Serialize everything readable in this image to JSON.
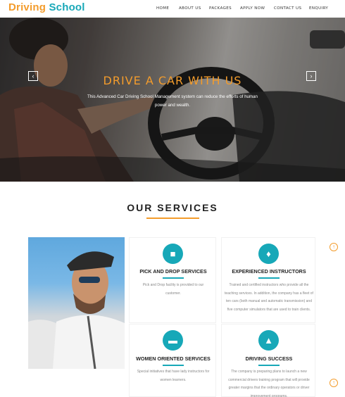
{
  "brand": {
    "part1": "Driving",
    "part2": "School"
  },
  "nav": [
    {
      "label": "HOME"
    },
    {
      "label": "ABOUT US"
    },
    {
      "label": "PACKAGES"
    },
    {
      "label": "APPLY NOW"
    },
    {
      "label": "CONTACT US"
    },
    {
      "label": "ENQUIRY"
    }
  ],
  "hero": {
    "title": "DRIVE A CAR WITH US",
    "text": "This Advanced Car Driving School Management system can reduce the efforts of human power and wealth.",
    "prev_icon": "chevron-left",
    "next_icon": "chevron-right"
  },
  "services": {
    "title": "OUR SERVICES",
    "items": [
      {
        "icon": "car",
        "title": "PICK AND DROP SERVICES",
        "desc": "Pick and Drop facility is provided to our customer."
      },
      {
        "icon": "bell",
        "title": "EXPERIENCED INSTRUCTORS",
        "desc": "Trained and certified instructors who provide all the teaching services. In addition, the company has a fleet of ten cars (both manual and automatic transmission) and five computer simulators that are used to train clients."
      },
      {
        "icon": "credit-card",
        "title": "WOMEN ORIENTED SERVICES",
        "desc": "Special initiatives that have lady instructors for women learners."
      },
      {
        "icon": "thumbs-up",
        "title": "DRIVING SUCCESS",
        "desc": "The company is preparing plans to launch a new commercial drivers training program that will provide greater margins that the ordinary operators or driver improvement programs."
      }
    ]
  },
  "colors": {
    "accent": "#f39c2c",
    "teal": "#17a8b8"
  }
}
